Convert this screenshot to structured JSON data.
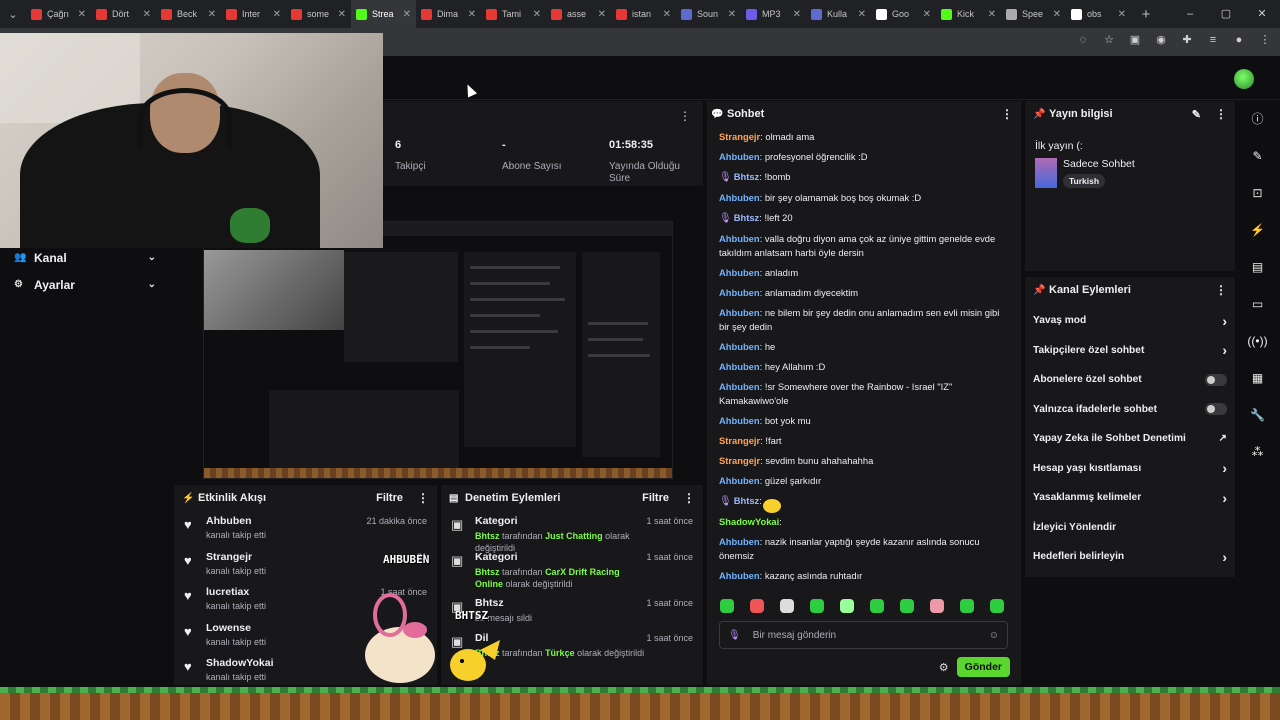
{
  "browser": {
    "tabs": [
      {
        "label": "Çağrı",
        "color": "#e53935"
      },
      {
        "label": "Dört",
        "color": "#e53935"
      },
      {
        "label": "Beck",
        "color": "#e53935"
      },
      {
        "label": "Inter",
        "color": "#e53935"
      },
      {
        "label": "some",
        "color": "#e53935"
      },
      {
        "label": "Strea",
        "color": "#53fc18",
        "active": true
      },
      {
        "label": "Dima",
        "color": "#e53935"
      },
      {
        "label": "Tami",
        "color": "#e53935"
      },
      {
        "label": "asse",
        "color": "#e53935"
      },
      {
        "label": "istan",
        "color": "#e53935"
      },
      {
        "label": "Soun",
        "color": "#5f6ad1"
      },
      {
        "label": "MP3",
        "color": "#6c5ce7"
      },
      {
        "label": "Kulla",
        "color": "#5f6ad1"
      },
      {
        "label": "Goo",
        "color": "#ffffff"
      },
      {
        "label": "Kick",
        "color": "#53fc18"
      },
      {
        "label": "Spee",
        "color": "#aaaaaa"
      },
      {
        "label": "obs",
        "color": "#ffffff"
      }
    ],
    "new_tab": "+",
    "window_controls": [
      "–",
      "▢",
      "✕"
    ]
  },
  "sidebar": {
    "items": [
      {
        "icon": "users-icon",
        "label": "Kanal"
      },
      {
        "icon": "gear-icon",
        "label": "Ayarlar"
      }
    ]
  },
  "stats": {
    "followers_value": "6",
    "followers_label": "Takipçi",
    "subs_value": "-",
    "subs_label": "Abone Sayısı",
    "live_value": "01:58:35",
    "live_label": "Yayında Olduğu Süre"
  },
  "activity_feed": {
    "title": "Etkinlik Akışı",
    "filter": "Filtre",
    "items": [
      {
        "name": "Ahbuben",
        "desc": "kanalı takip etti",
        "time": "21 dakika önce"
      },
      {
        "name": "Strangejr",
        "desc": "kanalı takip etti",
        "time": "21"
      },
      {
        "name": "lucretiax",
        "desc": "kanalı takip etti",
        "time": "1 saat önce"
      },
      {
        "name": "Lowense",
        "desc": "kanalı takip etti",
        "time": "önce"
      },
      {
        "name": "ShadowYokai",
        "desc": "kanalı takip etti",
        "time": ""
      }
    ]
  },
  "mod_actions": {
    "title": "Denetim Eylemleri",
    "filter": "Filtre",
    "items": [
      {
        "title": "Kategori",
        "user": "Bhtsz",
        "mid": "tarafından",
        "value": "Just Chatting",
        "tail": "olarak değiştirildi",
        "time": "1 saat önce"
      },
      {
        "title": "Kategori",
        "user": "Bhtsz",
        "mid": "tarafından",
        "value": "CarX Drift Racing Online",
        "tail": "olarak değiştirildi",
        "time": "1 saat önce"
      },
      {
        "title": "Bhtsz",
        "user": "",
        "mid": "bir mesajı sildi",
        "value": "",
        "tail": "",
        "time": "1 saat önce"
      },
      {
        "title": "Dil",
        "user": "Bhtsz",
        "mid": "tarafından",
        "value": "Türkçe",
        "tail": "olarak değiştirildi",
        "time": "1 saat önce"
      }
    ]
  },
  "chat": {
    "title": "Sohbet",
    "messages": [
      {
        "user": "Strangejr",
        "color": "#ffa54f",
        "text": "olmadı ama"
      },
      {
        "user": "Ahbuben",
        "color": "#6fb3ff",
        "text": "profesyonel öğrencilik :D"
      },
      {
        "user": "Bhtsz",
        "color": "#9ab8ff",
        "badge": true,
        "text": "!bomb"
      },
      {
        "user": "Ahbuben",
        "color": "#6fb3ff",
        "text": "bir şey olamamak boş boş okumak :D"
      },
      {
        "user": "Bhtsz",
        "color": "#9ab8ff",
        "badge": true,
        "text": "!left 20"
      },
      {
        "user": "Ahbuben",
        "color": "#6fb3ff",
        "text": "valla doğru diyon ama çok az üniye gittim genelde evde takıldım anlatsam harbi öyle dersin"
      },
      {
        "user": "Ahbuben",
        "color": "#6fb3ff",
        "text": "anladım"
      },
      {
        "user": "Ahbuben",
        "color": "#6fb3ff",
        "text": "anlamadım diyecektim"
      },
      {
        "user": "Ahbuben",
        "color": "#6fb3ff",
        "text": "ne bilem bir şey dedin onu anlamadım sen evli misin gibi bir şey dedin"
      },
      {
        "user": "Ahbuben",
        "color": "#6fb3ff",
        "text": "he"
      },
      {
        "user": "Ahbuben",
        "color": "#6fb3ff",
        "text": "hey Allahım :D"
      },
      {
        "user": "Ahbuben",
        "color": "#6fb3ff",
        "text": "!sr Somewhere over the Rainbow - Israel \"IZ\" Kamakawiwo'ole"
      },
      {
        "user": "Ahbuben",
        "color": "#6fb3ff",
        "text": "bot yok mu"
      },
      {
        "user": "Strangejr",
        "color": "#ffa54f",
        "text": "!fart"
      },
      {
        "user": "Strangejr",
        "color": "#ffa54f",
        "text": "sevdim bunu ahahahahha"
      },
      {
        "user": "Ahbuben",
        "color": "#6fb3ff",
        "text": "güzel şarkıdır"
      },
      {
        "user": "Bhtsz",
        "color": "#9ab8ff",
        "badge": true,
        "text": ""
      },
      {
        "user": "ShadowYokai",
        "color": "#7cfc4a",
        "text": ""
      },
      {
        "user": "Ahbuben",
        "color": "#6fb3ff",
        "text": "nazik insanlar yaptığı şeyde kazanır aslında sonucu önemsiz"
      },
      {
        "user": "Ahbuben",
        "color": "#6fb3ff",
        "text": "kazanç aslında ruhtadır"
      }
    ],
    "input_placeholder": "Bir mesaj gönderin",
    "send_label": "Gönder"
  },
  "stream_info": {
    "title": "Yayın bilgisi",
    "stream_title": "İlk yayın (:",
    "category": "Sadece Sohbet",
    "tag": "Turkish"
  },
  "channel_actions": {
    "title": "Kanal Eylemleri",
    "items": [
      {
        "label": "Yavaş mod",
        "kind": "chevron"
      },
      {
        "label": "Takipçilere özel sohbet",
        "kind": "chevron"
      },
      {
        "label": "Abonelere özel sohbet",
        "kind": "toggle"
      },
      {
        "label": "Yalnızca ifadelerle sohbet",
        "kind": "toggle"
      },
      {
        "label": "Yapay Zeka ile Sohbet Denetimi",
        "kind": "external"
      },
      {
        "label": "Hesap yaşı kısıtlaması",
        "kind": "chevron"
      },
      {
        "label": "Yasaklanmış kelimeler",
        "kind": "chevron"
      },
      {
        "label": "İzleyici Yönlendir",
        "kind": "none"
      },
      {
        "label": "Hedefleri belirleyin",
        "kind": "chevron"
      }
    ]
  },
  "overlay": {
    "name_tag_1": "AHBUBEN",
    "name_tag_2": "BHTSZ"
  },
  "colors": {
    "accent": "#53fc18",
    "bg": "#0e0e10",
    "panel": "#18181b"
  }
}
